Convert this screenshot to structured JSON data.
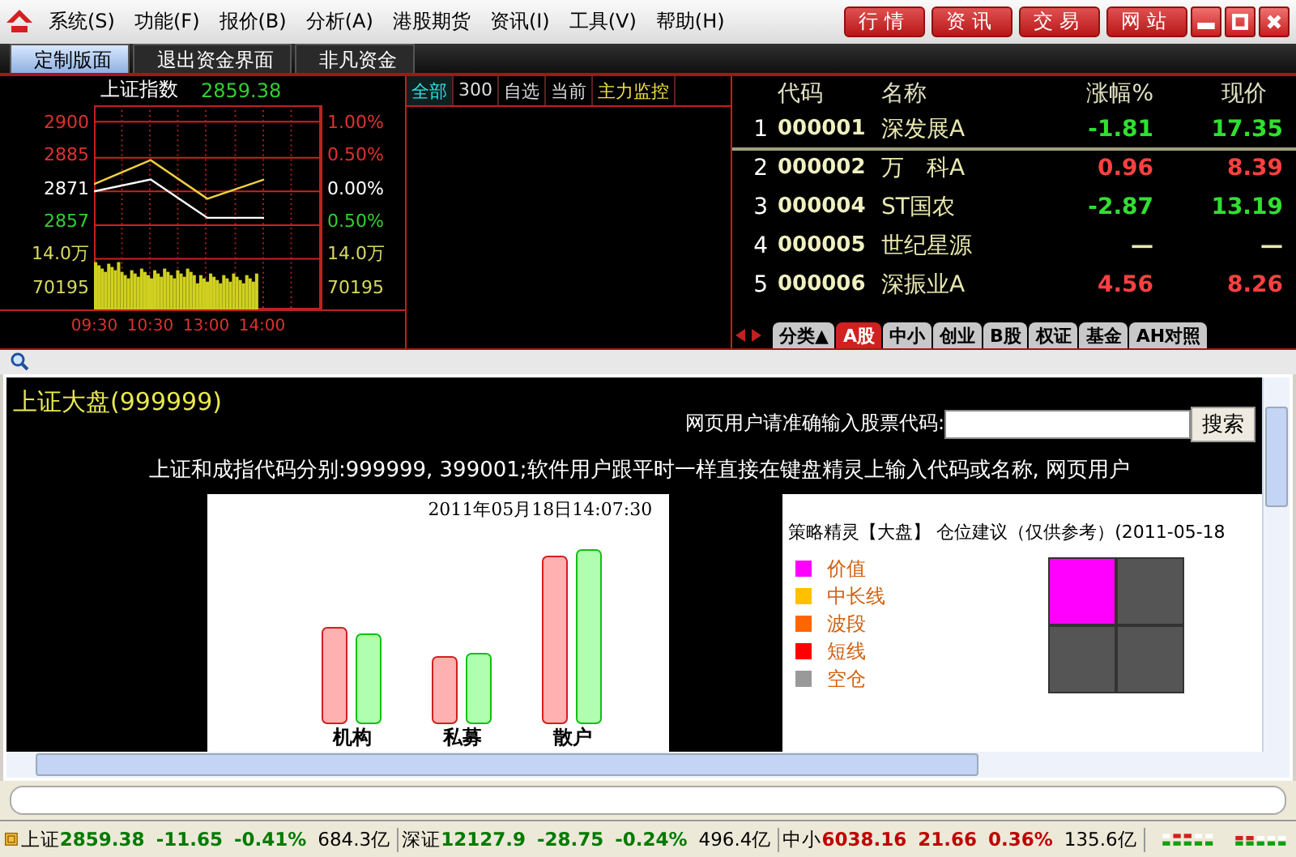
{
  "menu": {
    "items": [
      "系统(S)",
      "功能(F)",
      "报价(B)",
      "分析(A)",
      "港股期货",
      "资讯(I)",
      "工具(V)",
      "帮助(H)"
    ],
    "quick_buttons": [
      "行情",
      "资讯",
      "交易",
      "网站"
    ]
  },
  "tabs": [
    {
      "label": "定制版面",
      "selected": true
    },
    {
      "label": "退出资金界面",
      "selected": false
    },
    {
      "label": "非凡资金",
      "selected": false
    }
  ],
  "index_chart": {
    "title": "上证指数",
    "value": "2859.38",
    "left_ticks": [
      {
        "label": "2900",
        "kind": "up"
      },
      {
        "label": "2885",
        "kind": "up"
      },
      {
        "label": "2871",
        "kind": "flat"
      },
      {
        "label": "2857",
        "kind": "down"
      },
      {
        "label": "14.0万",
        "kind": "volume"
      },
      {
        "label": "70195",
        "kind": "volume"
      }
    ],
    "right_ticks": [
      {
        "label": "1.00%",
        "kind": "up"
      },
      {
        "label": "0.50%",
        "kind": "up"
      },
      {
        "label": "0.00%",
        "kind": "flat"
      },
      {
        "label": "0.50%",
        "kind": "down"
      },
      {
        "label": "14.0万",
        "kind": "volume"
      },
      {
        "label": "70195",
        "kind": "volume"
      }
    ],
    "chart_data": {
      "type": "line",
      "categories": [
        "09:30",
        "10:30",
        "13:00",
        "14:00"
      ],
      "series": [
        {
          "color": "#ffffff",
          "values": [
            2871,
            2876,
            2860,
            2860
          ]
        },
        {
          "color": "#f0d040",
          "values": [
            2874,
            2884,
            2868,
            2876
          ]
        }
      ],
      "ylim": [
        2843,
        2900
      ],
      "yticks": [
        2857,
        2871,
        2885,
        2900
      ],
      "grid": true
    }
  },
  "monitor_tabs": [
    {
      "label": "全部",
      "selected": true,
      "kind": "normal"
    },
    {
      "label": "300",
      "selected": false,
      "kind": "normal"
    },
    {
      "label": "自选",
      "selected": false,
      "kind": "normal"
    },
    {
      "label": "当前",
      "selected": false,
      "kind": "normal"
    },
    {
      "label": "主力监控",
      "selected": false,
      "kind": "highlight"
    }
  ],
  "quotes": {
    "columns": [
      "代码",
      "名称",
      "涨幅%",
      "现价"
    ],
    "rows": [
      {
        "rank": "1",
        "code": "000001",
        "name": "深发展A",
        "change": "-1.81",
        "price": "17.35",
        "color": "#30e030",
        "selected": true
      },
      {
        "rank": "2",
        "code": "000002",
        "name": "万　科A",
        "change": "0.96",
        "price": "8.39",
        "color": "#ff4040",
        "selected": false
      },
      {
        "rank": "3",
        "code": "000004",
        "name": "ST国农",
        "change": "-2.87",
        "price": "13.19",
        "color": "#30e030",
        "selected": false
      },
      {
        "rank": "4",
        "code": "000005",
        "name": "世纪星源",
        "change": "—",
        "price": "—",
        "color": "#e8e8b0",
        "selected": false
      },
      {
        "rank": "5",
        "code": "000006",
        "name": "深振业A",
        "change": "4.56",
        "price": "8.26",
        "color": "#ff4040",
        "selected": false
      }
    ],
    "tabs": [
      {
        "label": "分类▲",
        "selected": false
      },
      {
        "label": "A股",
        "selected": true
      },
      {
        "label": "中小",
        "selected": false
      },
      {
        "label": "创业",
        "selected": false
      },
      {
        "label": "B股",
        "selected": false
      },
      {
        "label": "权证",
        "selected": false
      },
      {
        "label": "基金",
        "selected": false
      },
      {
        "label": "AH对照",
        "selected": false
      }
    ]
  },
  "web": {
    "title": "上证大盘(999999)",
    "search_label": "网页用户请准确输入股票代码:",
    "search_button": "搜索",
    "notice": "上证和成指代码分别:999999, 399001;软件用户跟平时一样直接在键盘精灵上输入代码或名称, 网页用户",
    "fund_flow": {
      "timestamp": "2011年05月18日14:07:30",
      "groups": [
        "机构",
        "私募",
        "散户"
      ]
    },
    "strategy": {
      "title": "策略精灵【大盘】 仓位建议（仅供参考）(2011-05-18",
      "legend": [
        {
          "label": "价值",
          "color": "#ff00ff"
        },
        {
          "label": "中长线",
          "color": "#ffc000"
        },
        {
          "label": "波段",
          "color": "#ff6600"
        },
        {
          "label": "短线",
          "color": "#ff0000"
        },
        {
          "label": "空仓",
          "color": "#999999"
        }
      ],
      "cells": [
        {
          "filled": true
        },
        {
          "filled": false
        },
        {
          "filled": false
        },
        {
          "filled": false
        }
      ]
    }
  },
  "status_bar": [
    {
      "name": "上证",
      "value": "2859.38",
      "change": "-11.65",
      "pct": "-0.41%",
      "volume": "684.3亿",
      "color": "#007a00"
    },
    {
      "name": "深证",
      "value": "12127.9",
      "change": "-28.75",
      "pct": "-0.24%",
      "volume": "496.4亿",
      "color": "#007a00"
    },
    {
      "name": "中小",
      "value": "6038.16",
      "change": "21.66",
      "pct": "0.36%",
      "volume": "135.6亿",
      "color": "#c00000"
    }
  ]
}
